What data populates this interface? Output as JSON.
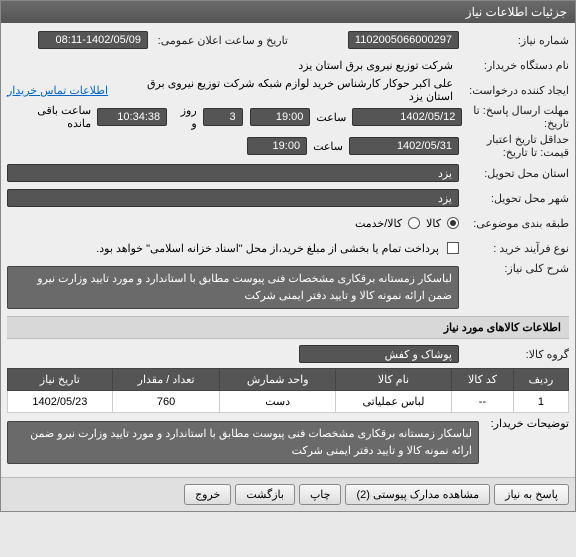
{
  "titlebar": "جزئیات اطلاعات نیاز",
  "labels": {
    "need_no": "شماره نیاز:",
    "announce_datetime": "تاریخ و ساعت اعلان عمومی:",
    "org_name": "نام دستگاه خریدار:",
    "requester": "ایجاد کننده درخواست:",
    "deadline": "مهلت ارسال پاسخ: تا تاریخ:",
    "at": "ساعت",
    "days": "روز و",
    "remaining": "ساعت باقی مانده",
    "validity": "حداقل تاریخ اعتبار قیمت: تا تاریخ:",
    "exec_province": "استان محل تحویل:",
    "exec_city": "شهر محل تحویل:",
    "budget_cat": "طبقه بندی موضوعی:",
    "process_type": "نوع فرآیند خرید :",
    "goods": "کالا",
    "service": "کالا/خدمت",
    "payment_note": "پرداخت تمام یا بخشی از مبلغ خرید،از محل \"اسناد خزانه اسلامی\" خواهد بود.",
    "general_desc": "شرح کلی نیاز:",
    "contact_link": "اطلاعات تماس خریدار",
    "buyer_notes": "توضیحات خریدار:",
    "goods_group": "گروه کالا:"
  },
  "fields": {
    "need_no": "1102005066000297",
    "announce_date": "1402/05/09",
    "announce_time": "08:11",
    "org_name": "شرکت توزیع نیروی برق استان یزد",
    "requester": "علی اکبر  حوکار  کارشناس خرید لوازم شبکه  شرکت توزیع نیروی برق استان یزد",
    "deadline_date": "1402/05/12",
    "deadline_time": "19:00",
    "days_left": "3",
    "time_left": "10:34:38",
    "validity_date": "1402/05/31",
    "validity_time": "19:00",
    "province": "یزد",
    "city": "یزد",
    "goods_group": "پوشاک و کفش",
    "description": "لباسکار زمستانه برقکاری مشخصات فنی پیوست مطابق با استاندارد و مورد تایید وزارت نیرو ضمن ارائه نمونه کالا و تایید دفتر ایمنی شرکت",
    "buyer_notes": "لباسکار زمستانه برقکاری مشخصات فنی پیوست مطابق با استاندارد و مورد تایید وزارت نیرو ضمن ارائه نمونه کالا و تایید دفتر ایمنی شرکت"
  },
  "goods_section": "اطلاعات کالاهای مورد نیاز",
  "table": {
    "headers": {
      "row": "ردیف",
      "code": "کد کالا",
      "name": "نام کالا",
      "unit": "واحد شمارش",
      "qty": "تعداد / مقدار",
      "date": "تاریخ نیاز"
    },
    "rows": [
      {
        "row": "1",
        "code": "--",
        "name": "لباس عملیاتی",
        "unit": "دست",
        "qty": "760",
        "date": "1402/05/23"
      }
    ]
  },
  "buttons": {
    "reply": "پاسخ به نیاز",
    "attachments": "مشاهده مدارک پیوستی (2)",
    "print": "چاپ",
    "back": "بازگشت",
    "exit": "خروج"
  }
}
